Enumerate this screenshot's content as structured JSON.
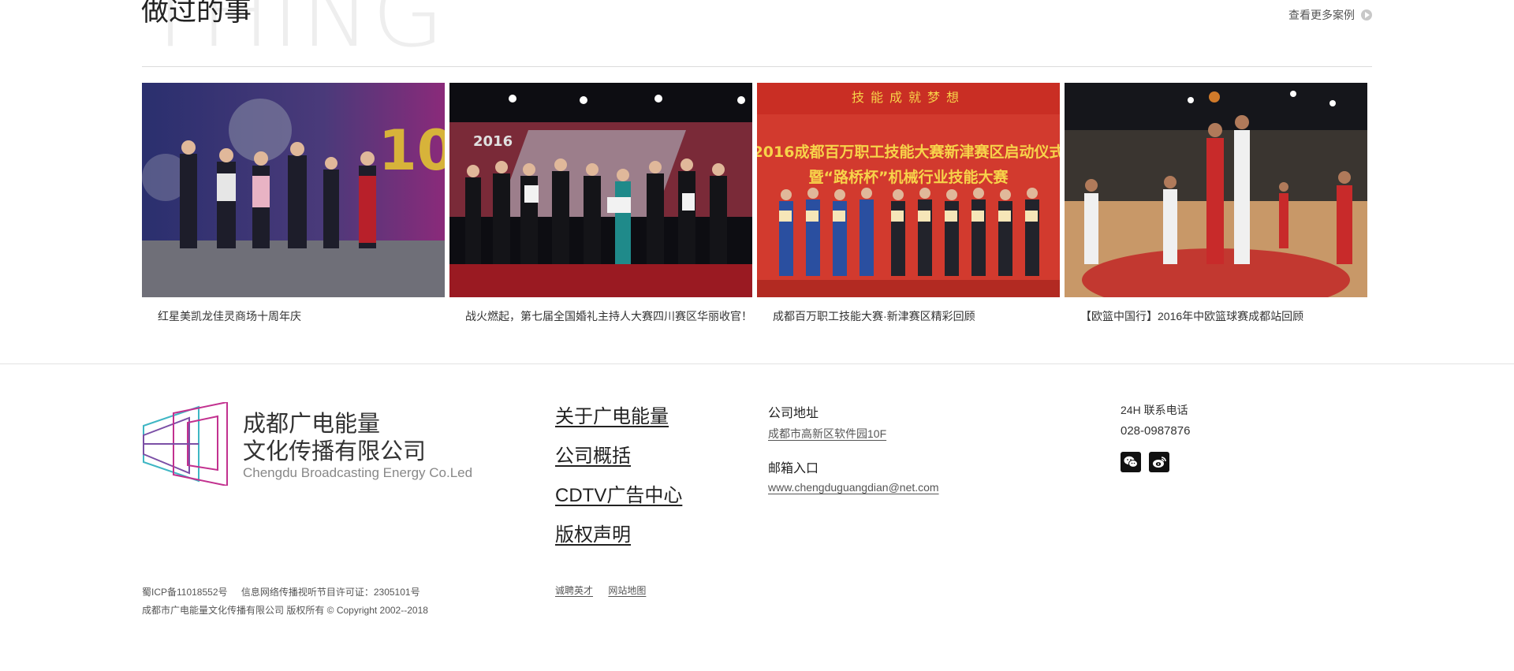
{
  "section": {
    "background_word": "THING",
    "title": "做过的事",
    "more_label": "查看更多案例"
  },
  "cases": [
    {
      "caption": "红星美凯龙佳灵商场十周年庆"
    },
    {
      "caption": "战火燃起，第七届全国婚礼主持人大赛四川赛区华丽收官！"
    },
    {
      "caption": "成都百万职工技能大赛·新津赛区精彩回顾"
    },
    {
      "caption": "【欧篮中国行】2016年中欧篮球赛成都站回顾"
    }
  ],
  "case_images": {
    "img2_text": "2016",
    "img3_banner_top": "技能成就梦想",
    "img3_banner_line1": "2016成都百万职工技能大赛新津赛区启动仪式",
    "img3_banner_line2": "暨“路桥杯”机械行业技能大赛"
  },
  "footer": {
    "logo_cn_line1": "成都广电能量",
    "logo_cn_line2": "文化传播有限公司",
    "logo_en": "Chengdu Broadcasting Energy Co.Led",
    "nav": [
      "关于广电能量",
      "公司概括",
      "CDTV广告中心",
      "版权声明"
    ],
    "address_label": "公司地址",
    "address_value": "成都市高新区软件园10F",
    "email_label": "邮箱入口",
    "email_value": "www.chengduguangdian@net.com",
    "phone_label": "24H 联系电话",
    "phone_value": "028-0987876",
    "icp": "蜀ICP备11018552号",
    "license": "信息网络传播视听节目许可证：2305101号",
    "copyright": "成都市广电能量文化传播有限公司 版权所有 © Copyright 2002--2018",
    "link_jobs": "诚聘英才",
    "link_sitemap": "网站地图"
  },
  "colors": {
    "logo_pink": "#c2318f",
    "logo_purple": "#7b4fa6",
    "logo_teal": "#3fb6c4"
  }
}
